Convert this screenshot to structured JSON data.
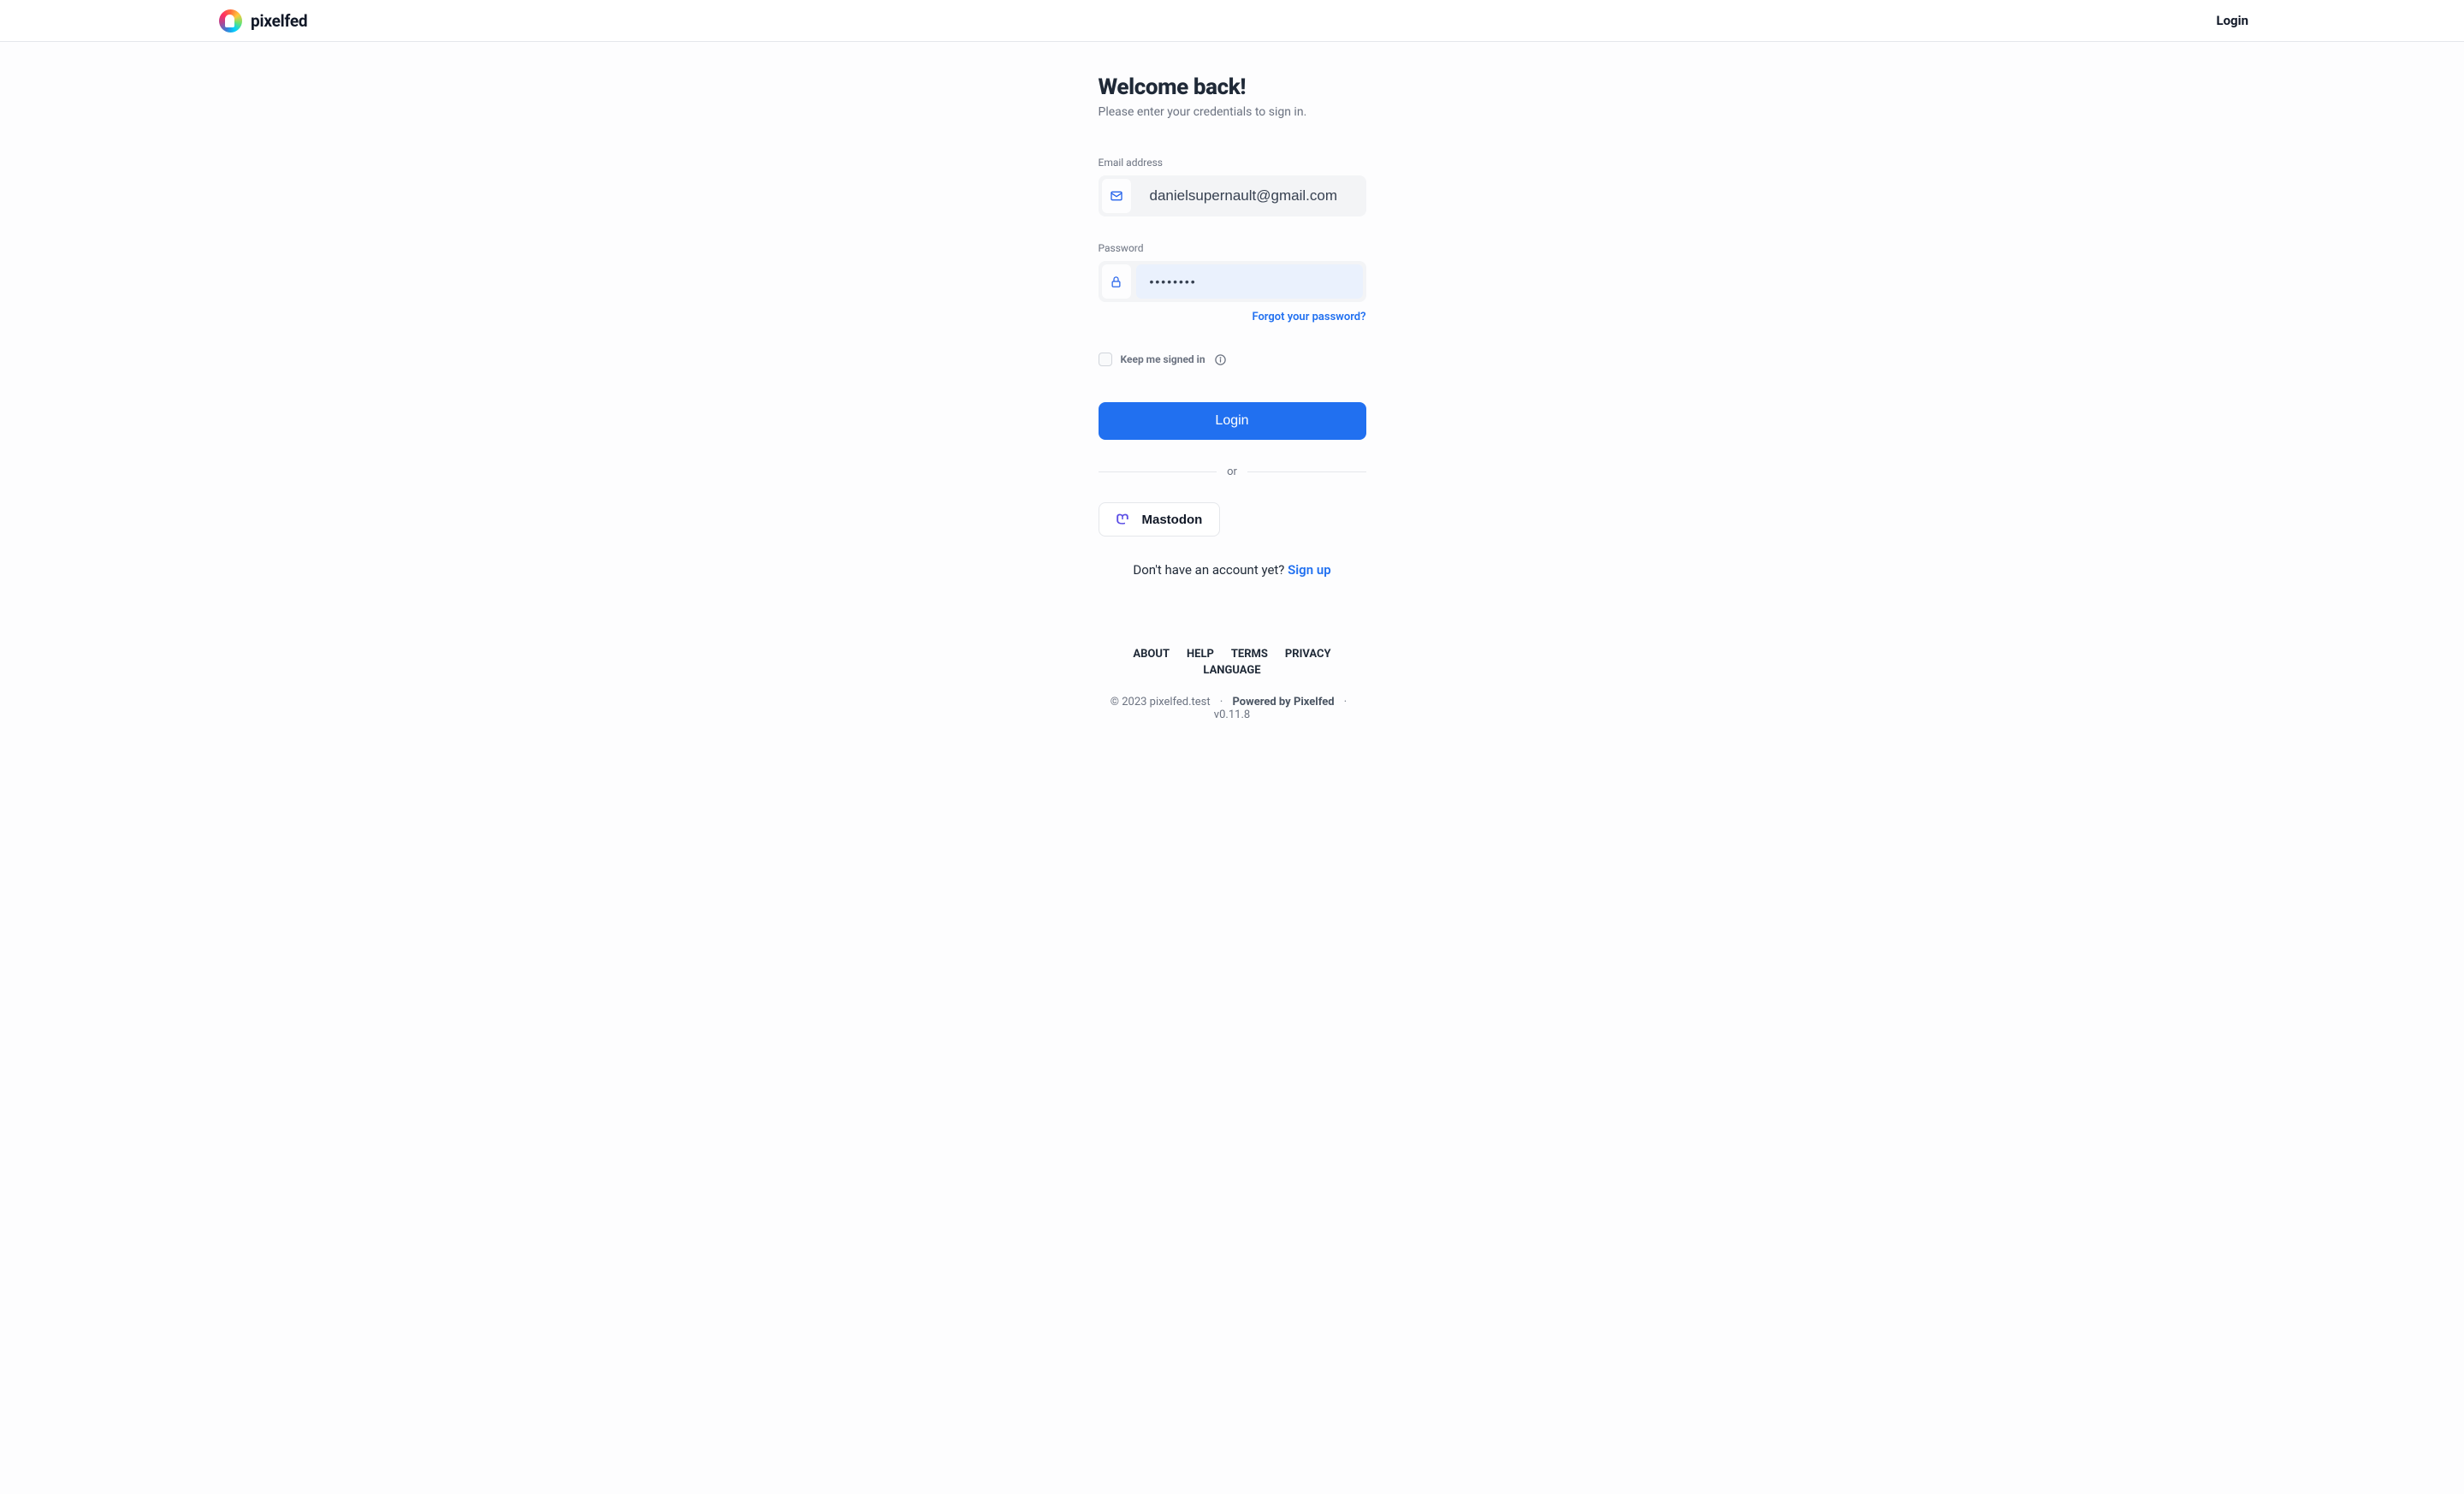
{
  "brand": {
    "name": "pixelfed"
  },
  "topbar": {
    "login_label": "Login"
  },
  "page": {
    "heading": "Welcome back!",
    "subheading": "Please enter your credentials to sign in."
  },
  "form": {
    "email_label": "Email address",
    "email_value": "danielsupernault@gmail.com",
    "password_label": "Password",
    "password_value": "••••••••",
    "forgot_label": "Forgot your password?",
    "remember_label": "Keep me signed in",
    "remember_checked": false,
    "login_button": "Login",
    "divider_text": "or",
    "mastodon_label": "Mastodon",
    "signup_prompt": "Don't have an account yet? ",
    "signup_link": "Sign up"
  },
  "footer": {
    "links": {
      "about": "ABOUT",
      "help": "HELP",
      "terms": "TERMS",
      "privacy": "PRIVACY",
      "language": "LANGUAGE"
    },
    "copyright": "© 2023 pixelfed.test",
    "powered_by": "Powered by Pixelfed",
    "version": "v0.11.8"
  }
}
